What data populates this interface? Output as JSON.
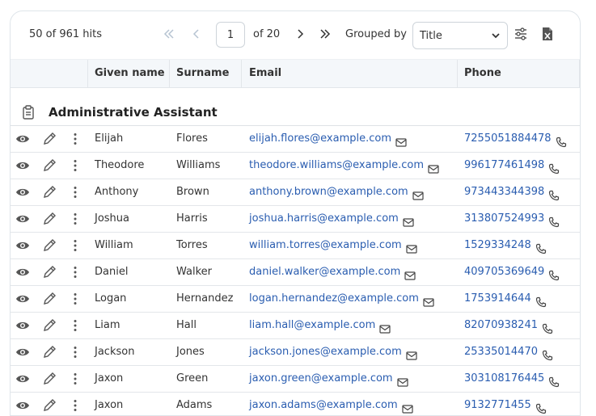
{
  "toolbar": {
    "hits_text": "50 of 961 hits",
    "page_value": "1",
    "of_text": "of 20",
    "grouped_by_label": "Grouped by",
    "group_value": "Title"
  },
  "columns": {
    "given_name": "Given name",
    "surname": "Surname",
    "email": "Email",
    "phone": "Phone"
  },
  "group": {
    "title": "Administrative Assistant"
  },
  "rows": [
    {
      "given": "Elijah",
      "surname": "Flores",
      "email": "elijah.flores@example.com",
      "phone": "7255051884478"
    },
    {
      "given": "Theodore",
      "surname": "Williams",
      "email": "theodore.williams@example.com",
      "phone": "996177461498"
    },
    {
      "given": "Anthony",
      "surname": "Brown",
      "email": "anthony.brown@example.com",
      "phone": "973443344398"
    },
    {
      "given": "Joshua",
      "surname": "Harris",
      "email": "joshua.harris@example.com",
      "phone": "313807524993"
    },
    {
      "given": "William",
      "surname": "Torres",
      "email": "william.torres@example.com",
      "phone": "1529334248"
    },
    {
      "given": "Daniel",
      "surname": "Walker",
      "email": "daniel.walker@example.com",
      "phone": "409705369649"
    },
    {
      "given": "Logan",
      "surname": "Hernandez",
      "email": "logan.hernandez@example.com",
      "phone": "1753914644"
    },
    {
      "given": "Liam",
      "surname": "Hall",
      "email": "liam.hall@example.com",
      "phone": "82070938241"
    },
    {
      "given": "Jackson",
      "surname": "Jones",
      "email": "jackson.jones@example.com",
      "phone": "25335014470"
    },
    {
      "given": "Jaxon",
      "surname": "Green",
      "email": "jaxon.green@example.com",
      "phone": "303108176445"
    },
    {
      "given": "Jaxon",
      "surname": "Adams",
      "email": "jaxon.adams@example.com",
      "phone": "9132771455"
    }
  ],
  "icons": {
    "first_page": "chevrons-left-icon",
    "prev_page": "chevron-left-icon",
    "next_page": "chevron-right-icon",
    "last_page": "chevrons-right-icon",
    "settings": "sliders-icon",
    "export": "excel-file-icon",
    "group": "clipboard-icon",
    "view": "eye-icon",
    "edit": "pencil-icon",
    "more": "vertical-dots-icon",
    "mail": "envelope-icon",
    "phone": "phone-icon"
  },
  "colors": {
    "link": "#2a5db0",
    "header_bg": "#f4f7fa",
    "disabled": "#b7c4d2"
  }
}
